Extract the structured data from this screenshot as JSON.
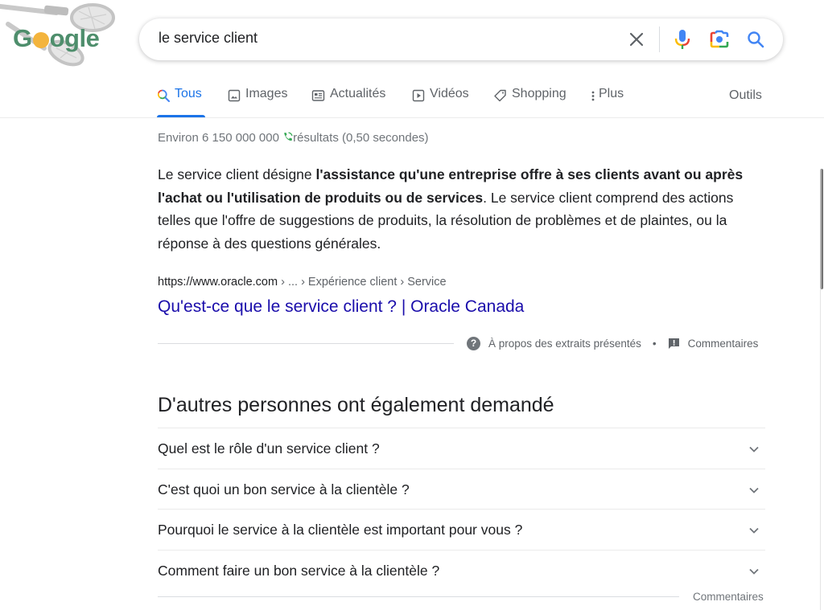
{
  "logo": {
    "text_prefix": "G",
    "text_suffix": "ogle",
    "alt": "Google Doodle (lacrosse)"
  },
  "search": {
    "query": "le service client",
    "icons": [
      "close-icon",
      "mic-icon",
      "lens-camera-icon",
      "search-icon"
    ]
  },
  "tabs": [
    {
      "label": "Tous",
      "icon": "search-icon",
      "active": true
    },
    {
      "label": "Images",
      "icon": "image-icon",
      "active": false
    },
    {
      "label": "Actualités",
      "icon": "news-icon",
      "active": false
    },
    {
      "label": "Vidéos",
      "icon": "play-icon",
      "active": false
    },
    {
      "label": "Shopping",
      "icon": "tag-icon",
      "active": false
    },
    {
      "label": "Plus",
      "icon": "more-vert-icon",
      "active": false
    }
  ],
  "tools_label": "Outils",
  "stats": {
    "prefix": "Environ 6 150 000 000",
    "suffix": "résultats (0,50 secondes)"
  },
  "snippet": {
    "text_before": "Le service client désigne ",
    "bold": "l'assistance qu'une entreprise offre à ses clients avant ou après l'achat ou l'utilisation de produits ou de services",
    "text_after": ". Le service client comprend des actions telles que l'offre de suggestions de produits, la résolution de problèmes et de plaintes, ou la réponse à des questions générales.",
    "source_domain": "https://www.oracle.com",
    "source_crumbs": " › ... › Expérience client › Service",
    "title": "Qu'est-ce que le service client ? | Oracle Canada",
    "about_label": "À propos des extraits présentés",
    "separator": "•",
    "feedback_label": "Commentaires"
  },
  "paa": {
    "title": "D'autres personnes ont également demandé",
    "questions": [
      "Quel est le rôle d'un service client ?",
      "C'est quoi un bon service à la clientèle ?",
      "Pourquoi le service à la clientèle est important pour vous ?",
      "Comment faire un bon service à la clientèle ?"
    ],
    "feedback_label": "Commentaires"
  },
  "colors": {
    "accent": "#1a73e8",
    "link": "#1a0dab",
    "text": "#202124",
    "secondary": "#5f6368",
    "logo_green": "#4e8e6c",
    "logo_ball": "#f3b43d"
  }
}
